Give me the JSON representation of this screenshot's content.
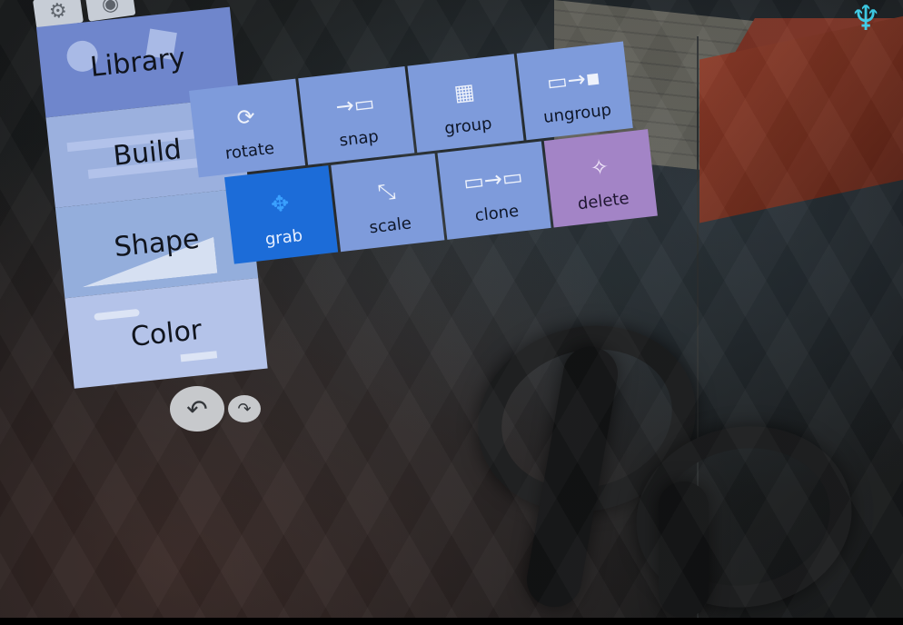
{
  "toolbar": {
    "top_icons": [
      {
        "name": "gear-icon",
        "glyph": "⚙"
      },
      {
        "name": "eye-icon",
        "glyph": "◉"
      }
    ]
  },
  "sidebar": {
    "items": [
      {
        "label": "Library"
      },
      {
        "label": "Build"
      },
      {
        "label": "Shape"
      },
      {
        "label": "Color"
      }
    ],
    "nav": {
      "back_glyph": "↶",
      "forward_glyph": "↷"
    }
  },
  "build_tools": {
    "row1": [
      {
        "label": "rotate",
        "glyph": "⟳"
      },
      {
        "label": "snap",
        "glyph": "→▭"
      },
      {
        "label": "group",
        "glyph": "▦"
      },
      {
        "label": "ungroup",
        "glyph": "▭→▪"
      }
    ],
    "row2": [
      {
        "label": "grab",
        "glyph": "✥",
        "active": true
      },
      {
        "label": "scale",
        "glyph": "⤡"
      },
      {
        "label": "clone",
        "glyph": "▭→▭"
      },
      {
        "label": "delete",
        "glyph": "✧"
      }
    ]
  },
  "colors": {
    "tile": "#7e9bdb",
    "active_tile": "#1c6cd8",
    "delete_tile": "#a384c6",
    "library": "#6f86cc"
  }
}
